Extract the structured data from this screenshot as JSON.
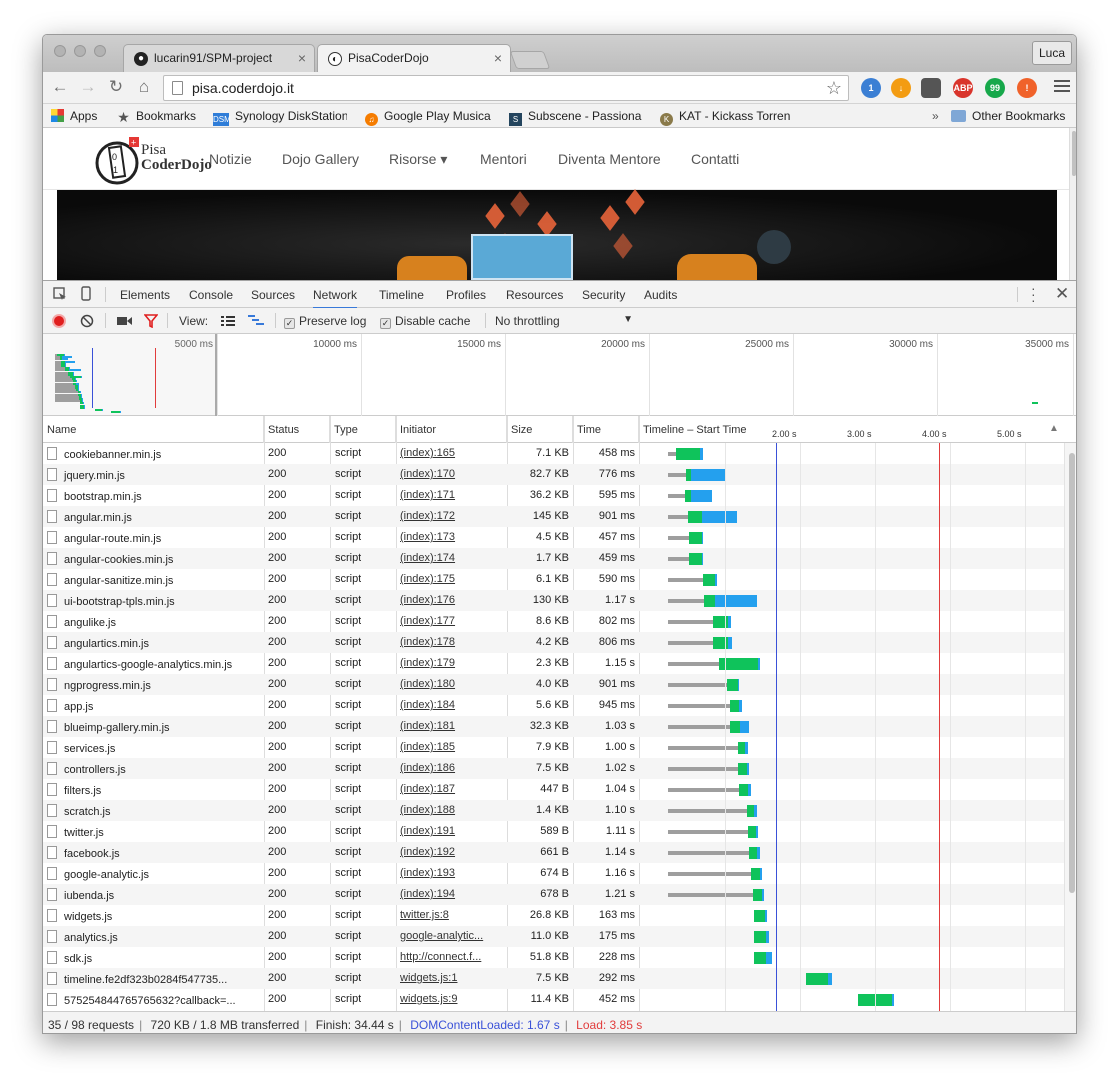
{
  "browser": {
    "tabs": [
      {
        "title": "lucarin91/SPM-project",
        "active": false
      },
      {
        "title": "PisaCoderDojo",
        "active": true
      }
    ],
    "user": "Luca",
    "url": "pisa.coderdojo.it",
    "bookmarks": [
      "Apps",
      "Bookmarks",
      "Synology DiskStation",
      "Google Play Musica",
      "Subscene - Passiona",
      "KAT - Kickass Torren"
    ],
    "other_bookmarks": "Other Bookmarks",
    "overflow": "»",
    "extensions": [
      {
        "name": "mail-checker-icon",
        "label": "1",
        "color": "#3b7fd4"
      },
      {
        "name": "download-icon",
        "label": "↓",
        "color": "#f39c12"
      },
      {
        "name": "pocket-icon",
        "label": "",
        "color": "#555555"
      },
      {
        "name": "adblock-icon",
        "label": "ABP",
        "color": "#d9342b"
      },
      {
        "name": "hangouts-icon",
        "label": "99",
        "color": "#17a84b"
      },
      {
        "name": "alert-icon",
        "label": "!",
        "color": "#f0622a"
      }
    ]
  },
  "site": {
    "logo_line1": "Pisa",
    "logo_line2": "CoderDojo",
    "nav": [
      "Notizie",
      "Dojo Gallery",
      "Risorse ▾",
      "Mentori",
      "Diventa Mentore",
      "Contatti"
    ]
  },
  "devtools": {
    "tabs": [
      "Elements",
      "Console",
      "Sources",
      "Network",
      "Timeline",
      "Profiles",
      "Resources",
      "Security",
      "Audits"
    ],
    "active_tab": "Network",
    "toolbar": {
      "view_label": "View:",
      "preserve_log": "Preserve log",
      "disable_cache": "Disable cache",
      "throttling": "No throttling"
    },
    "overview_ticks": [
      "5000 ms",
      "10000 ms",
      "15000 ms",
      "20000 ms",
      "25000 ms",
      "30000 ms",
      "35000 ms"
    ],
    "columns": [
      "Name",
      "Status",
      "Type",
      "Initiator",
      "Size",
      "Time",
      "Timeline – Start Time"
    ],
    "timeline_ticks": [
      "2.00 s",
      "3.00 s",
      "4.00 s",
      "5.00 s"
    ],
    "requests": [
      {
        "name": "cookiebanner.min.js",
        "status": "200",
        "type": "script",
        "initiator": "(index):165",
        "size": "7.1 KB",
        "time": "458 ms",
        "start": 0.36,
        "wait": 0.1,
        "recv": 0.33,
        "dl": 0.03
      },
      {
        "name": "jquery.min.js",
        "status": "200",
        "type": "script",
        "initiator": "(index):170",
        "size": "82.7 KB",
        "time": "776 ms",
        "start": 0.36,
        "wait": 0.24,
        "recv": 0.07,
        "dl": 0.46
      },
      {
        "name": "bootstrap.min.js",
        "status": "200",
        "type": "script",
        "initiator": "(index):171",
        "size": "36.2 KB",
        "time": "595 ms",
        "start": 0.36,
        "wait": 0.23,
        "recv": 0.07,
        "dl": 0.28
      },
      {
        "name": "angular.min.js",
        "status": "200",
        "type": "script",
        "initiator": "(index):172",
        "size": "145 KB",
        "time": "901 ms",
        "start": 0.36,
        "wait": 0.27,
        "recv": 0.18,
        "dl": 0.47
      },
      {
        "name": "angular-route.min.js",
        "status": "200",
        "type": "script",
        "initiator": "(index):173",
        "size": "4.5 KB",
        "time": "457 ms",
        "start": 0.36,
        "wait": 0.28,
        "recv": 0.17,
        "dl": 0.02
      },
      {
        "name": "angular-cookies.min.js",
        "status": "200",
        "type": "script",
        "initiator": "(index):174",
        "size": "1.7 KB",
        "time": "459 ms",
        "start": 0.36,
        "wait": 0.28,
        "recv": 0.17,
        "dl": 0.02
      },
      {
        "name": "angular-sanitize.min.js",
        "status": "200",
        "type": "script",
        "initiator": "(index):175",
        "size": "6.1 KB",
        "time": "590 ms",
        "start": 0.36,
        "wait": 0.47,
        "recv": 0.15,
        "dl": 0.03
      },
      {
        "name": "ui-bootstrap-tpls.min.js",
        "status": "200",
        "type": "script",
        "initiator": "(index):176",
        "size": "130 KB",
        "time": "1.17 s",
        "start": 0.36,
        "wait": 0.48,
        "recv": 0.14,
        "dl": 0.56
      },
      {
        "name": "angulike.js",
        "status": "200",
        "type": "script",
        "initiator": "(index):177",
        "size": "8.6 KB",
        "time": "802 ms",
        "start": 0.36,
        "wait": 0.6,
        "recv": 0.2,
        "dl": 0.04
      },
      {
        "name": "angulartics.min.js",
        "status": "200",
        "type": "script",
        "initiator": "(index):178",
        "size": "4.2 KB",
        "time": "806 ms",
        "start": 0.36,
        "wait": 0.6,
        "recv": 0.2,
        "dl": 0.05
      },
      {
        "name": "angulartics-google-analytics.min.js",
        "status": "200",
        "type": "script",
        "initiator": "(index):179",
        "size": "2.3 KB",
        "time": "1.15 s",
        "start": 0.36,
        "wait": 0.68,
        "recv": 0.52,
        "dl": 0.03
      },
      {
        "name": "ngprogress.min.js",
        "status": "200",
        "type": "script",
        "initiator": "(index):180",
        "size": "4.0 KB",
        "time": "901 ms",
        "start": 0.36,
        "wait": 0.78,
        "recv": 0.15,
        "dl": 0.02
      },
      {
        "name": "app.js",
        "status": "200",
        "type": "script",
        "initiator": "(index):184",
        "size": "5.6 KB",
        "time": "945 ms",
        "start": 0.36,
        "wait": 0.82,
        "recv": 0.13,
        "dl": 0.03
      },
      {
        "name": "blueimp-gallery.min.js",
        "status": "200",
        "type": "script",
        "initiator": "(index):181",
        "size": "32.3 KB",
        "time": "1.03 s",
        "start": 0.36,
        "wait": 0.83,
        "recv": 0.13,
        "dl": 0.12
      },
      {
        "name": "services.js",
        "status": "200",
        "type": "script",
        "initiator": "(index):185",
        "size": "7.9 KB",
        "time": "1.00 s",
        "start": 0.36,
        "wait": 0.93,
        "recv": 0.1,
        "dl": 0.03
      },
      {
        "name": "controllers.js",
        "status": "200",
        "type": "script",
        "initiator": "(index):186",
        "size": "7.5 KB",
        "time": "1.02 s",
        "start": 0.36,
        "wait": 0.93,
        "recv": 0.12,
        "dl": 0.03
      },
      {
        "name": "filters.js",
        "status": "200",
        "type": "script",
        "initiator": "(index):187",
        "size": "447 B",
        "time": "1.04 s",
        "start": 0.36,
        "wait": 0.95,
        "recv": 0.12,
        "dl": 0.03
      },
      {
        "name": "scratch.js",
        "status": "200",
        "type": "script",
        "initiator": "(index):188",
        "size": "1.4 KB",
        "time": "1.10 s",
        "start": 0.36,
        "wait": 1.05,
        "recv": 0.1,
        "dl": 0.03
      },
      {
        "name": "twitter.js",
        "status": "200",
        "type": "script",
        "initiator": "(index):191",
        "size": "589 B",
        "time": "1.11 s",
        "start": 0.36,
        "wait": 1.07,
        "recv": 0.1,
        "dl": 0.03
      },
      {
        "name": "facebook.js",
        "status": "200",
        "type": "script",
        "initiator": "(index):192",
        "size": "661 B",
        "time": "1.14 s",
        "start": 0.36,
        "wait": 1.08,
        "recv": 0.11,
        "dl": 0.03
      },
      {
        "name": "google-analytic.js",
        "status": "200",
        "type": "script",
        "initiator": "(index):193",
        "size": "674 B",
        "time": "1.16 s",
        "start": 0.36,
        "wait": 1.1,
        "recv": 0.12,
        "dl": 0.03
      },
      {
        "name": "iubenda.js",
        "status": "200",
        "type": "script",
        "initiator": "(index):194",
        "size": "678 B",
        "time": "1.21 s",
        "start": 0.36,
        "wait": 1.13,
        "recv": 0.12,
        "dl": 0.03
      },
      {
        "name": "widgets.js",
        "status": "200",
        "type": "script",
        "initiator": "twitter.js:8",
        "size": "26.8 KB",
        "time": "163 ms",
        "start": 1.5,
        "wait": 0,
        "recv": 0.15,
        "dl": 0.03
      },
      {
        "name": "analytics.js",
        "status": "200",
        "type": "script",
        "initiator": "google-analytic...",
        "size": "11.0 KB",
        "time": "175 ms",
        "start": 1.5,
        "wait": 0,
        "recv": 0.17,
        "dl": 0.03
      },
      {
        "name": "sdk.js",
        "status": "200",
        "type": "script",
        "initiator": "http://connect.f...",
        "size": "51.8 KB",
        "time": "228 ms",
        "start": 1.5,
        "wait": 0,
        "recv": 0.17,
        "dl": 0.07
      },
      {
        "name": "timeline.fe2df323b0284f547735...",
        "status": "200",
        "type": "script",
        "initiator": "widgets.js:1",
        "size": "7.5 KB",
        "time": "292 ms",
        "start": 2.2,
        "wait": 0,
        "recv": 0.29,
        "dl": 0.05
      },
      {
        "name": "575254844765765632?callback=...",
        "status": "200",
        "type": "script",
        "initiator": "widgets.js:9",
        "size": "11.4 KB",
        "time": "452 ms",
        "start": 2.89,
        "wait": 0,
        "recv": 0.45,
        "dl": 0.03
      }
    ],
    "summary": {
      "requests": "35 / 98 requests",
      "transferred": "720 KB / 1.8 MB transferred",
      "finish": "Finish: 34.44 s",
      "dcl": "DOMContentLoaded: 1.67 s",
      "load": "Load: 3.85 s",
      "dcl_color": "#3a51d8",
      "load_color": "#e13c3c"
    }
  }
}
